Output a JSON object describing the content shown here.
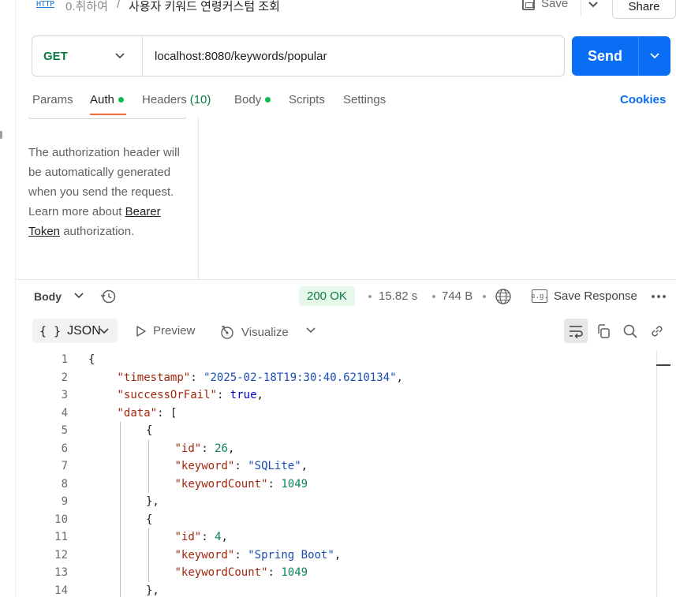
{
  "header": {
    "method_badge": "HTTP",
    "collection": "0.취하여",
    "separator": "/",
    "request_name": "사용자 키워드 연령커스텀 조회",
    "save_label": "Save",
    "share_label": "Share"
  },
  "request": {
    "method": "GET",
    "url": "localhost:8080/keywords/popular",
    "send_label": "Send"
  },
  "tabs": {
    "params": "Params",
    "auth": "Auth",
    "headers": "Headers",
    "headers_count": "(10)",
    "body": "Body",
    "scripts": "Scripts",
    "settings": "Settings",
    "cookies": "Cookies"
  },
  "auth": {
    "desc_before": "The authorization header will be automatically generated when you send the request. Learn more about",
    "link": "Bearer Token",
    "desc_after": "authorization."
  },
  "response": {
    "body_label": "Body",
    "status": "200 OK",
    "time": "15.82 s",
    "size": "744 B",
    "save_response": "Save Response",
    "format": "JSON",
    "format_braces": "{ }",
    "preview": "Preview",
    "visualize": "Visualize"
  },
  "code": [
    {
      "n": "1",
      "indent": 0,
      "tokens": [
        {
          "t": "p",
          "v": "{"
        }
      ]
    },
    {
      "n": "2",
      "indent": 1,
      "tokens": [
        {
          "t": "k",
          "v": "\"timestamp\""
        },
        {
          "t": "p",
          "v": ": "
        },
        {
          "t": "s",
          "v": "\"2025-02-18T19:30:40.6210134\""
        },
        {
          "t": "p",
          "v": ","
        }
      ]
    },
    {
      "n": "3",
      "indent": 1,
      "tokens": [
        {
          "t": "k",
          "v": "\"successOrFail\""
        },
        {
          "t": "p",
          "v": ": "
        },
        {
          "t": "b",
          "v": "true"
        },
        {
          "t": "p",
          "v": ","
        }
      ]
    },
    {
      "n": "4",
      "indent": 1,
      "tokens": [
        {
          "t": "k",
          "v": "\"data\""
        },
        {
          "t": "p",
          "v": ": ["
        }
      ]
    },
    {
      "n": "5",
      "indent": 2,
      "tokens": [
        {
          "t": "p",
          "v": "{"
        }
      ]
    },
    {
      "n": "6",
      "indent": 3,
      "tokens": [
        {
          "t": "k",
          "v": "\"id\""
        },
        {
          "t": "p",
          "v": ": "
        },
        {
          "t": "n",
          "v": "26"
        },
        {
          "t": "p",
          "v": ","
        }
      ]
    },
    {
      "n": "7",
      "indent": 3,
      "tokens": [
        {
          "t": "k",
          "v": "\"keyword\""
        },
        {
          "t": "p",
          "v": ": "
        },
        {
          "t": "s",
          "v": "\"SQLite\""
        },
        {
          "t": "p",
          "v": ","
        }
      ]
    },
    {
      "n": "8",
      "indent": 3,
      "tokens": [
        {
          "t": "k",
          "v": "\"keywordCount\""
        },
        {
          "t": "p",
          "v": ": "
        },
        {
          "t": "n",
          "v": "1049"
        }
      ]
    },
    {
      "n": "9",
      "indent": 2,
      "tokens": [
        {
          "t": "p",
          "v": "},"
        }
      ]
    },
    {
      "n": "10",
      "indent": 2,
      "tokens": [
        {
          "t": "p",
          "v": "{"
        }
      ]
    },
    {
      "n": "11",
      "indent": 3,
      "tokens": [
        {
          "t": "k",
          "v": "\"id\""
        },
        {
          "t": "p",
          "v": ": "
        },
        {
          "t": "n",
          "v": "4"
        },
        {
          "t": "p",
          "v": ","
        }
      ]
    },
    {
      "n": "12",
      "indent": 3,
      "tokens": [
        {
          "t": "k",
          "v": "\"keyword\""
        },
        {
          "t": "p",
          "v": ": "
        },
        {
          "t": "s",
          "v": "\"Spring Boot\""
        },
        {
          "t": "p",
          "v": ","
        }
      ]
    },
    {
      "n": "13",
      "indent": 3,
      "tokens": [
        {
          "t": "k",
          "v": "\"keywordCount\""
        },
        {
          "t": "p",
          "v": ": "
        },
        {
          "t": "n",
          "v": "1049"
        }
      ]
    },
    {
      "n": "14",
      "indent": 2,
      "tokens": [
        {
          "t": "p",
          "v": "},"
        }
      ]
    }
  ],
  "icons": {
    "save": "floppy-icon",
    "history": "history-icon",
    "globe": "globe-icon",
    "example": "example-icon",
    "wrap": "wrap-lines-icon",
    "copy": "copy-icon",
    "search": "search-icon",
    "link": "link-icon"
  },
  "colors": {
    "accent": "#0a6ef5",
    "method": "#0b7a3e",
    "status_bg": "#e6f7ec",
    "tab_indicator": "#f26b3a"
  }
}
